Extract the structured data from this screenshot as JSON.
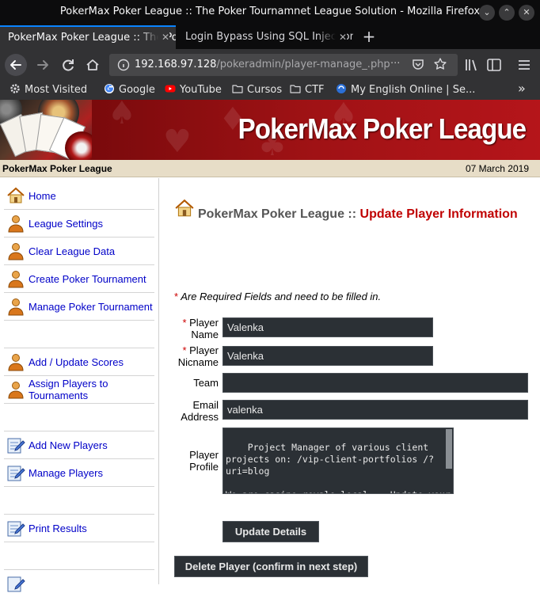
{
  "window": {
    "title": "PokerMax Poker League :: The Poker Tournamnet League Solution - Mozilla Firefox",
    "btn_minimize": "⌄",
    "btn_maximize": "⌃",
    "btn_close": "✕"
  },
  "tabs": [
    {
      "label": "PokerMax Poker League :: The Poker Tournamnet League Solution",
      "close": "✕"
    },
    {
      "label": "Login Bypass Using SQL Injection",
      "close": "✕"
    }
  ],
  "newtab_label": "+",
  "nav": {
    "url_host": "192.168.97.128",
    "url_path": "/pokeradmin/player-manage_.php",
    "more_actions": "···"
  },
  "bookmarks": [
    {
      "label": "Most Visited",
      "icon": "gear-icon"
    },
    {
      "label": "Google",
      "icon": "google-icon"
    },
    {
      "label": "YouTube",
      "icon": "youtube-icon"
    },
    {
      "label": "Cursos",
      "icon": "folder-icon"
    },
    {
      "label": "CTF",
      "icon": "folder-icon"
    },
    {
      "label": "My English Online | Se...",
      "icon": "globe-icon"
    }
  ],
  "bookmarks_overflow": "»",
  "banner": {
    "title": "PokerMax Poker League"
  },
  "subbar": {
    "league": "PokerMax Poker League",
    "date": "07 March 2019"
  },
  "sidebar": {
    "items": [
      {
        "label": "Home",
        "icon": "home-icon"
      },
      {
        "label": "League Settings",
        "icon": "user-icon"
      },
      {
        "label": "Clear League Data",
        "icon": "user-icon"
      },
      {
        "label": "Create Poker Tournament",
        "icon": "user-icon"
      },
      {
        "label": "Manage Poker Tournament",
        "icon": "user-icon"
      },
      {
        "label": "Add / Update Scores",
        "icon": "user-icon"
      },
      {
        "label": "Assign Players to Tournaments",
        "icon": "user-icon"
      },
      {
        "label": "Add New Players",
        "icon": "edit-icon"
      },
      {
        "label": "Manage Players",
        "icon": "edit-icon"
      },
      {
        "label": "Print Results",
        "icon": "edit-icon"
      }
    ]
  },
  "main": {
    "heading_site": "PokerMax Poker League ::",
    "heading_page": "Update Player Information",
    "required_mark": "*",
    "required_note": "Are Required Fields and need to be filled in.",
    "fields": {
      "player_name": {
        "label": "Player Name",
        "value": "Valenka"
      },
      "player_nicname": {
        "label": "Player Nicname",
        "value": "Valenka"
      },
      "team": {
        "label": "Team",
        "value": ""
      },
      "email": {
        "label": "Email Address",
        "value": "valenka"
      },
      "profile": {
        "label": "Player Profile",
        "value": "Project Manager of various client projects on: /vip-client-portfolios /?uri=blog\n\nWe are casino-royale.local -- Update your hosts file!"
      }
    },
    "update_button": "Update Details",
    "delete_button": "Delete Player (confirm in next step)"
  },
  "colors": {
    "chrome_dark": "#0c0c0d",
    "toolbar": "#323234",
    "banner_red": "#8b0d10",
    "heading_red": "#c00000",
    "link_blue": "#0000c8",
    "input_dark": "#2b3035"
  }
}
